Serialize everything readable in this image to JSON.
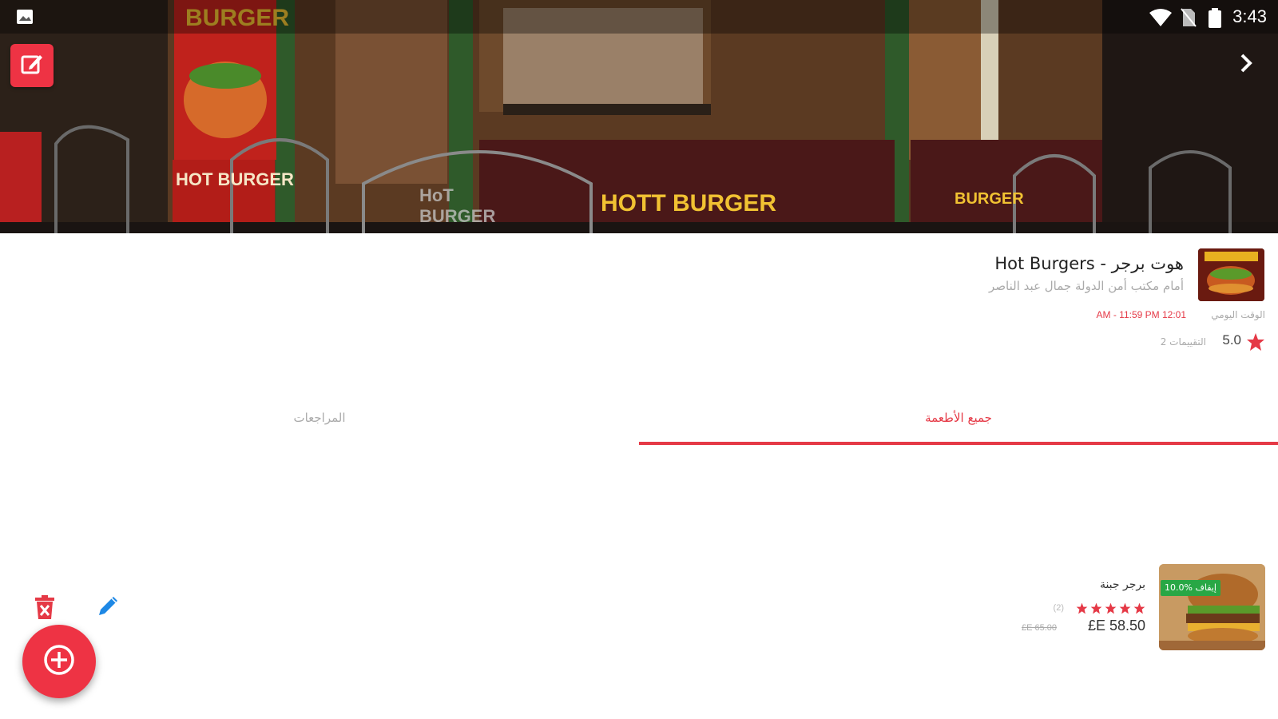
{
  "status_bar": {
    "time": "3:43",
    "icons": [
      "image-icon",
      "wifi-icon",
      "no-sim-icon",
      "battery-icon"
    ]
  },
  "hero": {
    "photo": "restaurant-storefront-photo",
    "sign_texts": [
      "BURGER",
      "HOT BURGER",
      "HoT BURGER",
      "HOTT BURGER",
      "BURGER"
    ]
  },
  "restaurant": {
    "name": "هوت برجر - Hot Burgers",
    "address": "أمام مكتب أمن الدولة جمال عبد الناصر",
    "hours_label": "الوقت اليومي",
    "hours": "AM - 11:59 PM 12:01",
    "rating": "5.0",
    "rating_count": "2 التقييمات"
  },
  "tabs": [
    {
      "label": "جميع الأطعمة",
      "active": true
    },
    {
      "label": "المراجعات",
      "active": false
    }
  ],
  "items": [
    {
      "name": "برجر جبنة",
      "stars": 5,
      "review_count": "(2)",
      "price": "£E 58.50",
      "old_price": "£E 65.00",
      "discount": "10.0% إيقاف"
    }
  ],
  "colors": {
    "accent": "#ee3344",
    "accent_text": "#e53946",
    "muted_text": "#aaaaaa",
    "discount_badge": "#28a745",
    "edit_pencil": "#1e88e5"
  }
}
